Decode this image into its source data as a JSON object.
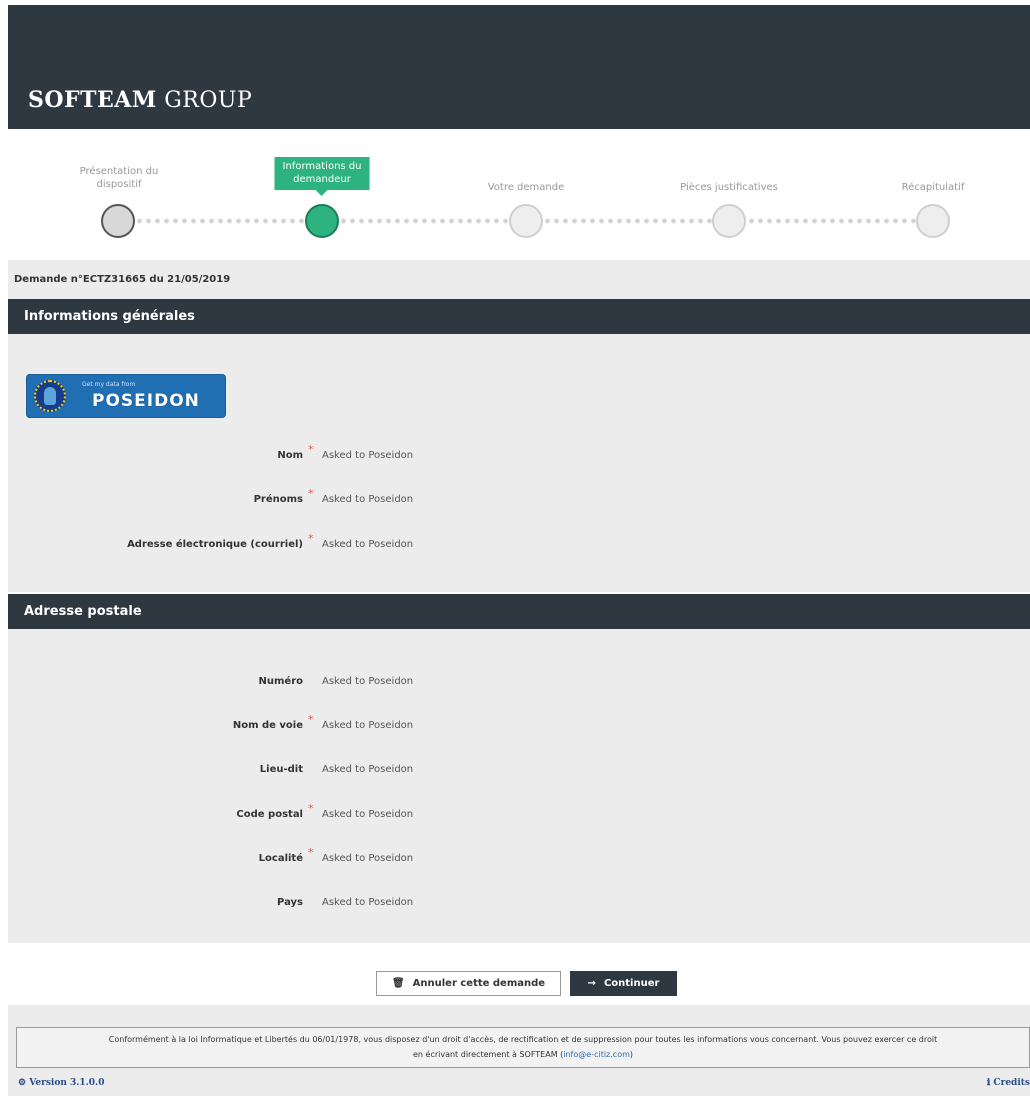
{
  "header": {
    "brand_bold": "SOFTEAM",
    "brand_rest": " GROUP"
  },
  "stepper": {
    "steps": [
      {
        "label": "Présentation du\ndispositif",
        "state": "done"
      },
      {
        "label": "Informations du\ndemandeur",
        "state": "active"
      },
      {
        "label": "Votre demande",
        "state": "todo"
      },
      {
        "label": "Pièces justificatives",
        "state": "todo"
      },
      {
        "label": "Récapitulatif",
        "state": "todo"
      }
    ]
  },
  "request": {
    "title": "Demande n°ECTZ31665 du 21/05/2019"
  },
  "general": {
    "heading": "Informations générales",
    "poseidon": {
      "small": "Get my data from",
      "big": "POSEIDON"
    },
    "fields": [
      {
        "label": "Nom",
        "required": true,
        "value": "Asked to Poseidon"
      },
      {
        "label": "Prénoms",
        "required": true,
        "value": "Asked to Poseidon"
      },
      {
        "label": "Adresse électronique (courriel)",
        "required": true,
        "value": "Asked to Poseidon"
      }
    ]
  },
  "postal": {
    "heading": "Adresse postale",
    "fields": [
      {
        "label": "Numéro",
        "required": false,
        "value": "Asked to Poseidon"
      },
      {
        "label": "Nom de voie",
        "required": true,
        "value": "Asked to Poseidon"
      },
      {
        "label": "Lieu-dit",
        "required": false,
        "value": "Asked to Poseidon"
      },
      {
        "label": "Code postal",
        "required": true,
        "value": "Asked to Poseidon"
      },
      {
        "label": "Localité",
        "required": true,
        "value": "Asked to Poseidon"
      },
      {
        "label": "Pays",
        "required": false,
        "value": "Asked to Poseidon"
      }
    ]
  },
  "actions": {
    "cancel_label": "Annuler cette demande",
    "continue_label": "Continuer"
  },
  "footer": {
    "notice_line1": "Conformément à la loi Informatique et Libertés du 06/01/1978, vous disposez d'un droit d'accès, de rectification et de suppression pour toutes les informations vous concernant. Vous pouvez exercer ce droit",
    "notice_line2_prefix": "en écrivant directement à SOFTEAM (",
    "notice_email": "info@e-citiz.com",
    "notice_line2_suffix": ")",
    "version": "Version 3.1.0.0",
    "credits": "Credits"
  },
  "colors": {
    "header_bg": "#2d3840",
    "accent_green": "#2db37f",
    "panel_bg": "#ececec",
    "required_star": "#e25555"
  },
  "icons": [
    "eu-stars-icon",
    "trash-icon",
    "arrow-right-icon",
    "version-icon",
    "info-icon"
  ]
}
